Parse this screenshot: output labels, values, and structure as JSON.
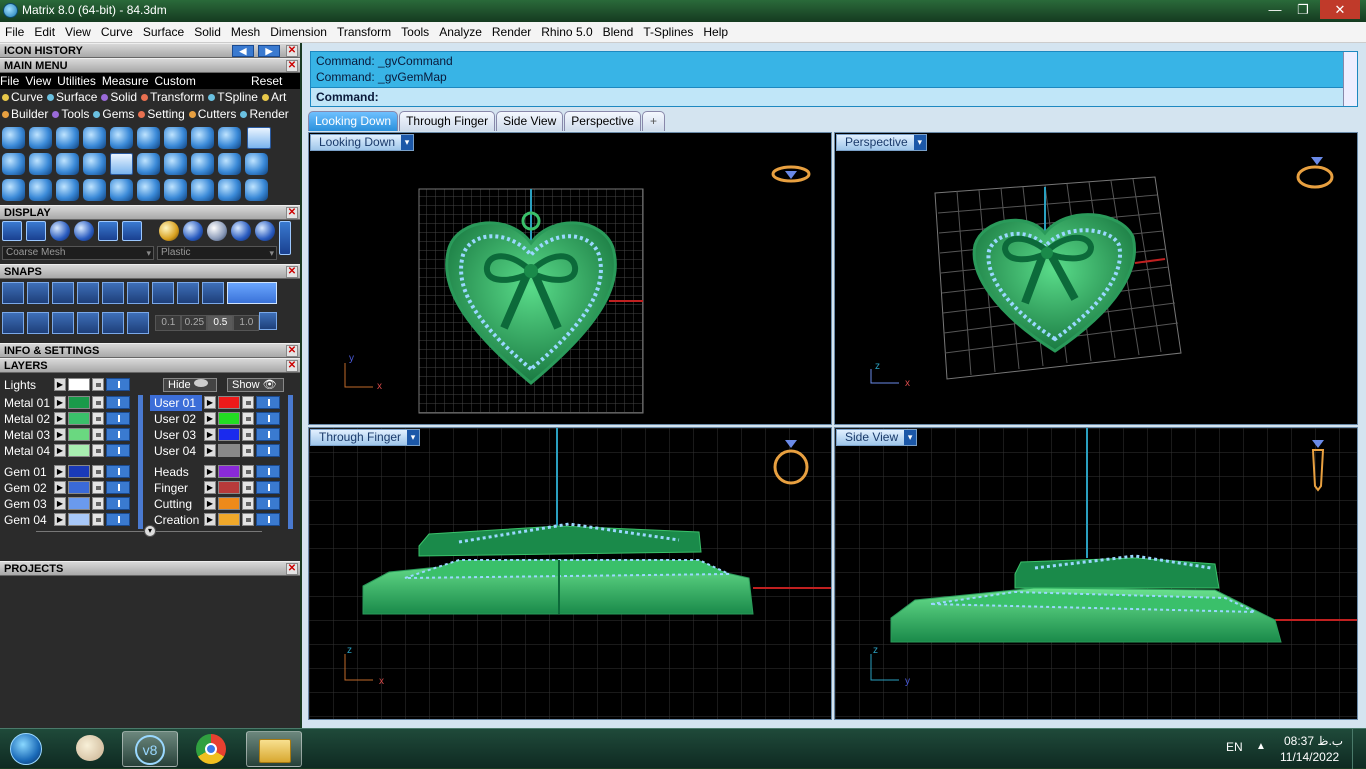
{
  "window": {
    "title": "Matrix 8.0 (64-bit) - 84.3dm",
    "controls": [
      "—",
      "❐",
      "✕"
    ]
  },
  "menubar": [
    "File",
    "Edit",
    "View",
    "Curve",
    "Surface",
    "Solid",
    "Mesh",
    "Dimension",
    "Transform",
    "Tools",
    "Analyze",
    "Render",
    "Rhino 5.0",
    "Blend",
    "T-Splines",
    "Help"
  ],
  "left": {
    "icon_history": "ICON HISTORY",
    "main_menu": "MAIN MENU",
    "main_menu_items": [
      "File",
      "View",
      "Utilities",
      "Measure",
      "Custom"
    ],
    "reset": "Reset",
    "cat_row1": [
      "Curve",
      "Surface",
      "Solid",
      "Transform",
      "TSpline",
      "Art"
    ],
    "cat_row2": [
      "Builder",
      "Tools",
      "Gems",
      "Setting",
      "Cutters",
      "Render"
    ],
    "cat_colors1": [
      "#e8c84a",
      "#6ac0e0",
      "#9a6ad8",
      "#e87050",
      "#6ac0e0",
      "#e8c84a"
    ],
    "cat_colors2": [
      "#e8a040",
      "#9a6ad8",
      "#6ac0e0",
      "#e87050",
      "#e8a040",
      "#6ac0e0"
    ],
    "display": "DISPLAY",
    "display_dd1": "Coarse Mesh",
    "display_dd2": "Plastic",
    "snaps": "SNAPS",
    "grid_snap_values": [
      "0.1",
      "0.25",
      "0.5",
      "1.0"
    ],
    "info": "INFO & SETTINGS",
    "layers": "LAYERS",
    "lights": "Lights",
    "hide": "Hide",
    "show": "Show",
    "metal_layers": [
      {
        "name": "Metal 01",
        "color": "#1a9a4a"
      },
      {
        "name": "Metal 02",
        "color": "#3ac06a"
      },
      {
        "name": "Metal 03",
        "color": "#6ad880"
      },
      {
        "name": "Metal 04",
        "color": "#a8eeb0"
      }
    ],
    "user_layers": [
      {
        "name": "User 01",
        "color": "#ee1a1a"
      },
      {
        "name": "User 02",
        "color": "#22dd22"
      },
      {
        "name": "User 03",
        "color": "#1a2aee"
      },
      {
        "name": "User 04",
        "color": "#888888"
      }
    ],
    "gem_layers": [
      {
        "name": "Gem 01",
        "color": "#1a3ab8"
      },
      {
        "name": "Gem 02",
        "color": "#3a6ad8"
      },
      {
        "name": "Gem 03",
        "color": "#6a9aee"
      },
      {
        "name": "Gem 04",
        "color": "#a8c8f8"
      }
    ],
    "misc_layers": [
      {
        "name": "Heads",
        "color": "#8a2ad8"
      },
      {
        "name": "Finger",
        "color": "#b83a3a"
      },
      {
        "name": "Cutting",
        "color": "#ee8a1a"
      },
      {
        "name": "Creation",
        "color": "#f0a82a"
      }
    ],
    "projects": "PROJECTS"
  },
  "command": {
    "history": [
      "Command: _gvCommand",
      "Command: _gvGemMap"
    ],
    "prompt": "Command:"
  },
  "tabs": [
    "Looking Down",
    "Through Finger",
    "Side View",
    "Perspective",
    "+"
  ],
  "viewports": {
    "top_left": "Looking Down",
    "top_right": "Perspective",
    "bottom_left": "Through Finger",
    "bottom_right": "Side View"
  },
  "axes": {
    "x": "x",
    "y": "y",
    "z": "z"
  },
  "taskbar": {
    "lang": "EN",
    "time": "08:37 ب.ظ",
    "date": "11/14/2022",
    "matrix_icon_label": "v8"
  }
}
